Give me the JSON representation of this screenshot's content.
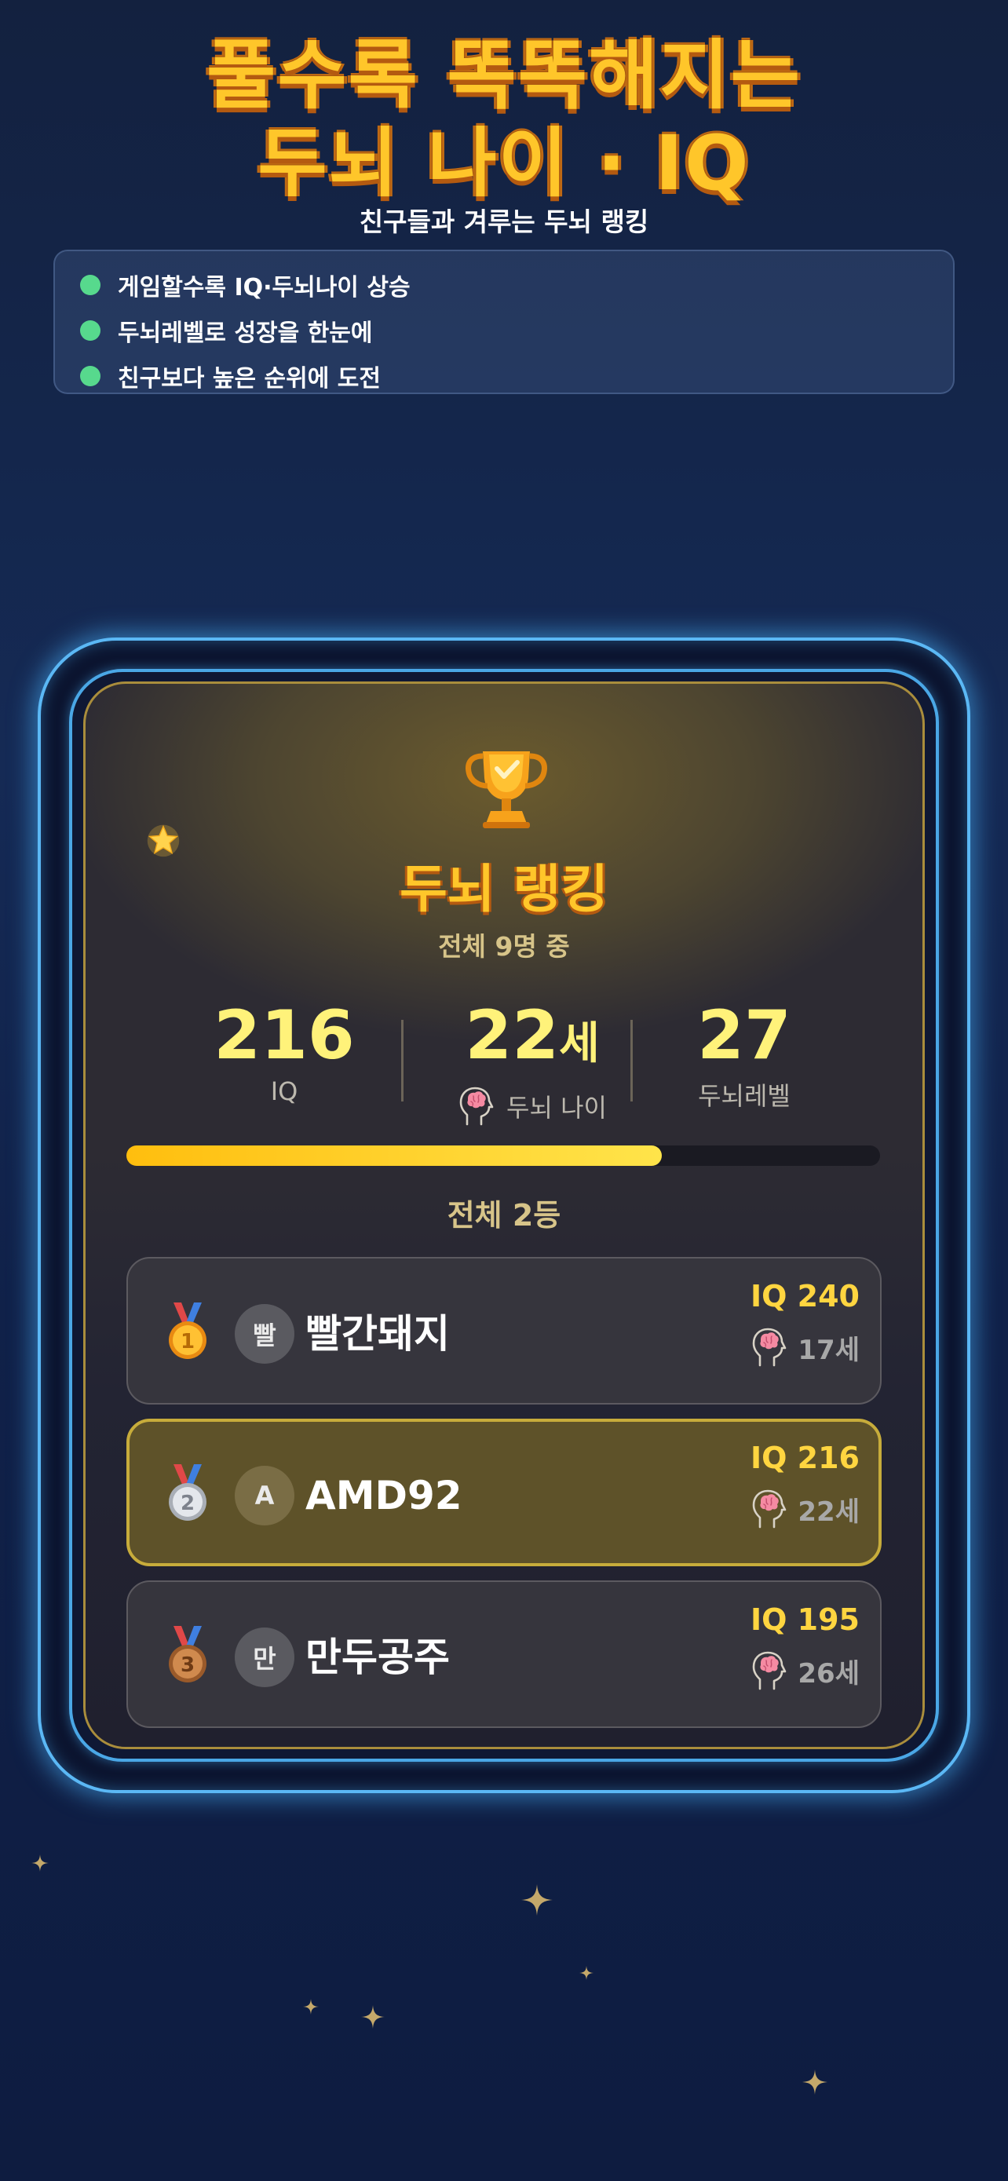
{
  "hero": {
    "title_line1": "풀수록 똑똑해지는",
    "title_line2": "두뇌 나이 · IQ",
    "subtitle": "친구들과 겨루는 두뇌 랭킹"
  },
  "features": [
    {
      "text": "게임할수록 IQ·두뇌나이 상승"
    },
    {
      "text": "두뇌레벨로 성장을 한눈에"
    },
    {
      "text": "친구보다 높은 순위에 도전"
    }
  ],
  "card": {
    "title": "두뇌 랭킹",
    "total_text": "전체 9명 중",
    "stats": {
      "iq_value": "216",
      "iq_label": "IQ",
      "age_value": "22",
      "age_unit": "세",
      "age_label": "두뇌 나이",
      "level_value": "27",
      "level_label": "두뇌레벨"
    },
    "progress": 0.71,
    "position_text": "전체 2등",
    "rows": [
      {
        "rank": "1",
        "avatar": "빨",
        "name": "빨간돼지",
        "iq": "IQ 240",
        "age": "17세",
        "me": false
      },
      {
        "rank": "2",
        "avatar": "A",
        "name": "AMD92",
        "iq": "IQ 216",
        "age": "22세",
        "me": true
      },
      {
        "rank": "3",
        "avatar": "만",
        "name": "만두공주",
        "iq": "IQ 195",
        "age": "26세",
        "me": false
      }
    ]
  },
  "colors": {
    "gold": "#ffc62a",
    "highlight_row": "#5e5229",
    "feature_dot": "#57d98d",
    "frame_glow": "#5bb8f5"
  },
  "icons": [
    "trophy-icon",
    "star-icon",
    "brain-head-icon",
    "gold-medal-icon",
    "silver-medal-icon",
    "bronze-medal-icon",
    "sparkle-icon"
  ]
}
